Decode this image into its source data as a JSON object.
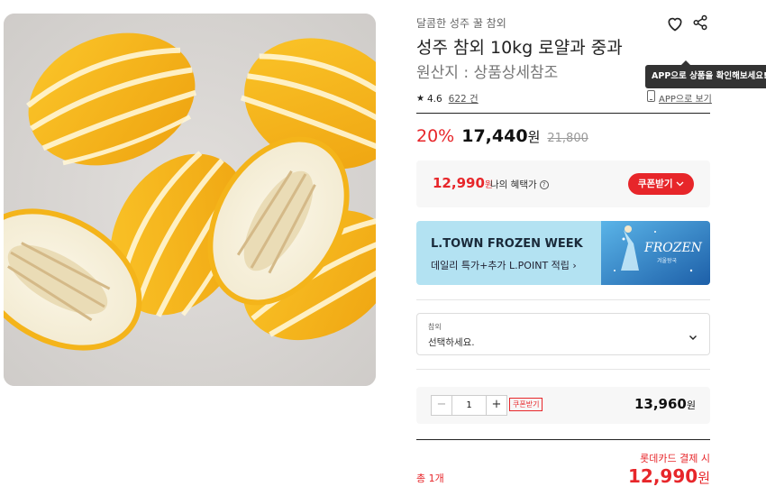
{
  "product": {
    "subtitle": "달콤한 성주 꿀 참외",
    "title": "성주 참외 10kg 로얄과 중과",
    "origin": "원산지 : 상품상세참조",
    "image_alt": "참외"
  },
  "rating": {
    "score": "4.6",
    "count": "622 건"
  },
  "app": {
    "view_label": "APP으로 보기",
    "tooltip": "APP으로 상품을 확인해보세요!"
  },
  "pricing": {
    "discount": "20%",
    "price": "17,440",
    "unit": "원",
    "original": "21,800"
  },
  "benefit": {
    "price": "12,990",
    "unit": "원",
    "label": "나의 혜택가",
    "coupon_button": "쿠폰받기"
  },
  "banner": {
    "title": "L.TOWN FROZEN WEEK",
    "subtitle": "데일리 특가+추가 L.POINT 적립",
    "logo_text": "FROZEN",
    "logo_sub": "겨울왕국"
  },
  "option": {
    "label": "참외",
    "placeholder": "선택하세요."
  },
  "quantity": {
    "minus": "−",
    "value": "1",
    "plus": "+",
    "coupon_label": "쿠폰받기",
    "price": "13,960",
    "unit": "원"
  },
  "total": {
    "label": "총 1개",
    "card_note": "롯데카드 결제 시",
    "price": "12,990",
    "unit": "원"
  },
  "colors": {
    "accent": "#e7262a",
    "banner_bg": "#b3e2f2",
    "melon_yellow": "#f4b41a"
  }
}
